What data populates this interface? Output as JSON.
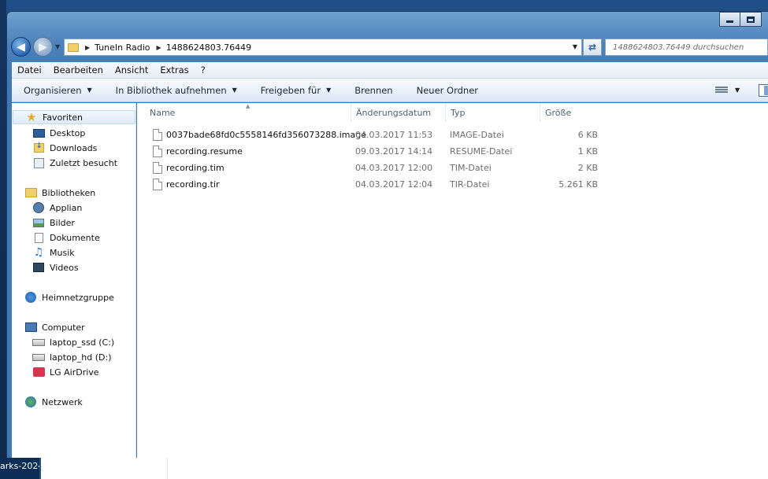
{
  "window": {
    "caption_buttons": [
      "minimize",
      "maximize"
    ]
  },
  "address": {
    "crumbs": [
      "TuneIn Radio",
      "1488624803.76449"
    ]
  },
  "search": {
    "placeholder": "1488624803.76449 durchsuchen"
  },
  "menubar": {
    "items": [
      "Datei",
      "Bearbeiten",
      "Ansicht",
      "Extras",
      "?"
    ]
  },
  "commandbar": {
    "items": [
      "Organisieren",
      "In Bibliothek aufnehmen",
      "Freigeben für",
      "Brennen",
      "Neuer Ordner"
    ]
  },
  "navpane": {
    "favorites": {
      "label": "Favoriten",
      "items": [
        "Desktop",
        "Downloads",
        "Zuletzt besucht"
      ]
    },
    "libraries": {
      "label": "Bibliotheken",
      "items": [
        "Applian",
        "Bilder",
        "Dokumente",
        "Musik",
        "Videos"
      ]
    },
    "homegroup": {
      "label": "Heimnetzgruppe"
    },
    "computer": {
      "label": "Computer",
      "items": [
        "laptop_ssd (C:)",
        "laptop_hd (D:)",
        "LG AirDrive"
      ]
    },
    "network": {
      "label": "Netzwerk"
    }
  },
  "filelist": {
    "columns": [
      "Name",
      "Änderungsdatum",
      "Typ",
      "Größe"
    ],
    "rows": [
      {
        "name": "0037bade68fd0c5558146fd356073288.image",
        "date": "04.03.2017 11:53",
        "type": "IMAGE-Datei",
        "size": "6 KB"
      },
      {
        "name": "recording.resume",
        "date": "09.03.2017 14:14",
        "type": "RESUME-Datei",
        "size": "1 KB"
      },
      {
        "name": "recording.tim",
        "date": "04.03.2017 12:00",
        "type": "TIM-Datei",
        "size": "2 KB"
      },
      {
        "name": "recording.tir",
        "date": "04.03.2017 12:04",
        "type": "TIR-Datei",
        "size": "5.261 KB"
      }
    ]
  },
  "taskbar": {
    "left_label": "arks-2024"
  }
}
